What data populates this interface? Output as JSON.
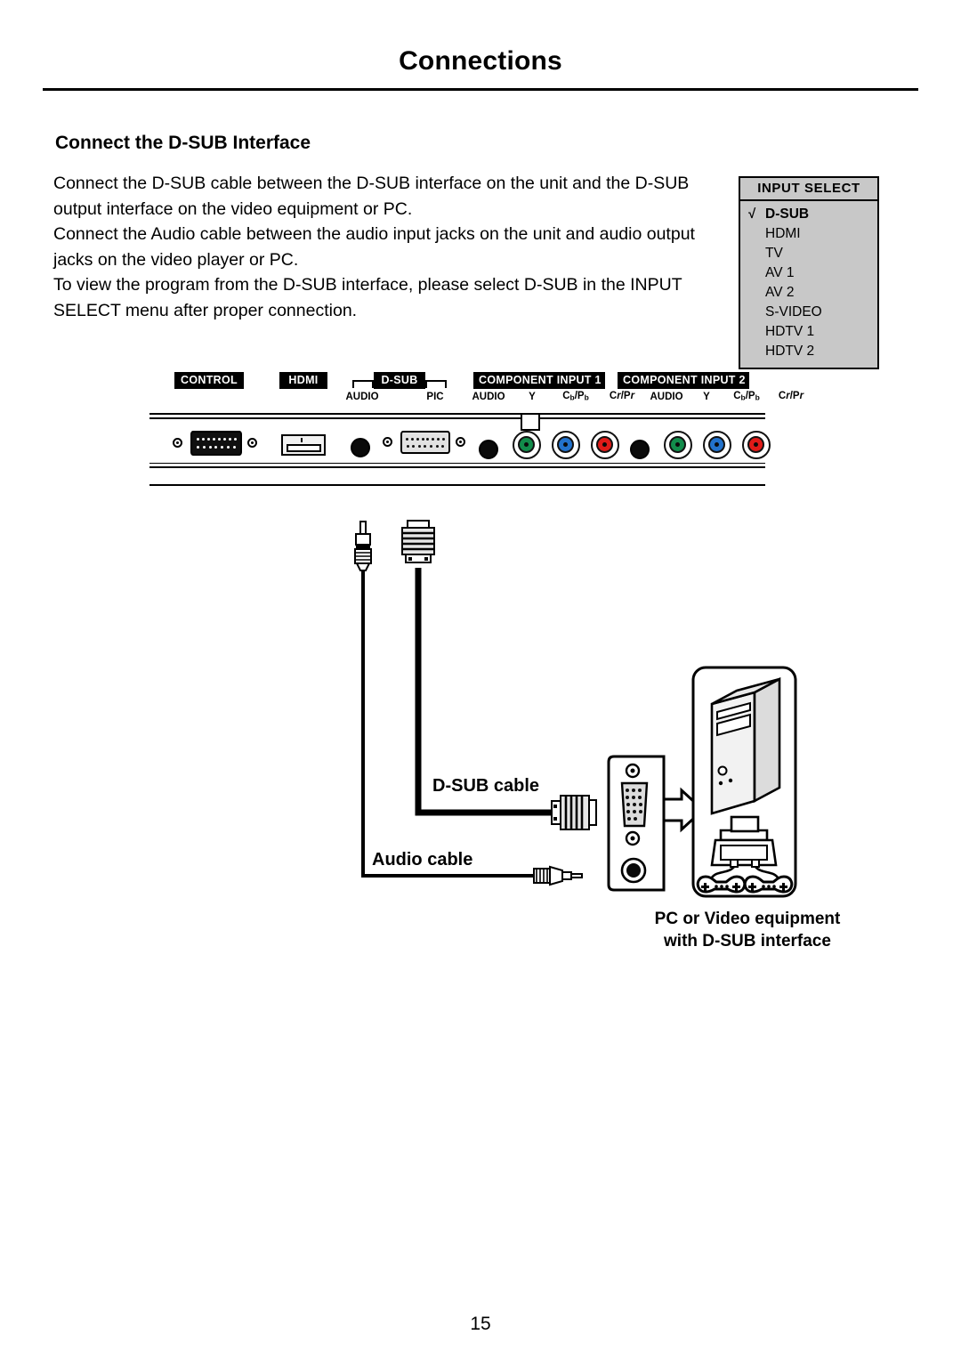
{
  "document": {
    "page_title": "Connections",
    "page_number": "15"
  },
  "section": {
    "heading": "Connect the D-SUB Interface",
    "paragraphs": [
      "Connect the D-SUB cable between the D-SUB interface on the unit and the D-SUB output interface on the video equipment or PC.",
      "Connect the Audio cable between the audio input jacks on the unit and audio output jacks on the video player or PC.",
      "To view the program from the D-SUB interface, please select D-SUB in the INPUT SELECT menu after proper connection."
    ]
  },
  "input_select_menu": {
    "title": "INPUT SELECT",
    "check_glyph": "√",
    "items": [
      {
        "label": "D-SUB",
        "selected": true
      },
      {
        "label": "HDMI",
        "selected": false
      },
      {
        "label": "TV",
        "selected": false
      },
      {
        "label": "AV 1",
        "selected": false
      },
      {
        "label": "AV 2",
        "selected": false
      },
      {
        "label": "S-VIDEO",
        "selected": false
      },
      {
        "label": "HDTV 1",
        "selected": false
      },
      {
        "label": "HDTV 2",
        "selected": false
      }
    ],
    "background_color": "#c8c8c8"
  },
  "rear_panel": {
    "tags": {
      "control": "CONTROL",
      "hdmi": "HDMI",
      "dsub": "D-SUB",
      "component1": "COMPONENT INPUT 1",
      "component2": "COMPONENT INPUT 2"
    },
    "sub_labels": {
      "dsub_audio": "AUDIO",
      "dsub_pic": "PIC",
      "c1_audio": "AUDIO",
      "c1_y": "Y",
      "c2_audio": "AUDIO",
      "c2_y": "Y"
    },
    "jack_colors": {
      "audio": "#0a0a0a",
      "y": "#128c4b",
      "cb_pb": "#2272cc",
      "cr_pr": "#e01b18"
    }
  },
  "cable_diagram": {
    "dsub_cable_label": "D-SUB cable",
    "audio_cable_label": "Audio cable",
    "equipment_caption_line1": "PC or Video equipment",
    "equipment_caption_line2": "with D-SUB interface"
  }
}
